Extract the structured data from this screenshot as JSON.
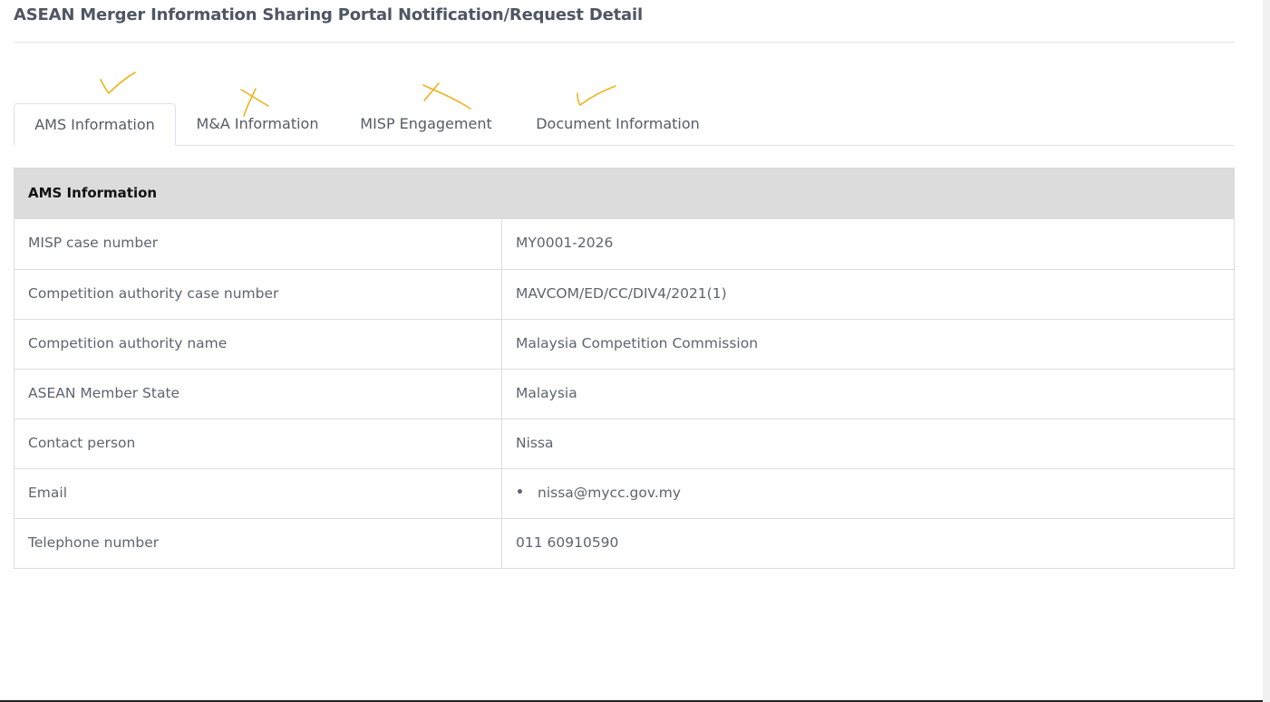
{
  "page": {
    "title": "ASEAN Merger Information Sharing Portal Notification/Request Detail"
  },
  "tabs": [
    {
      "label": "AMS Information",
      "active": true,
      "annotation": "check-mark"
    },
    {
      "label": "M&A Information",
      "active": false,
      "annotation": "cross-mark"
    },
    {
      "label": "MISP Engagement",
      "active": false,
      "annotation": "cross-mark"
    },
    {
      "label": "Document Information",
      "active": false,
      "annotation": "check-mark"
    }
  ],
  "colors": {
    "annotation_ink": "#f0b21e",
    "table_header_bg": "#dcdcdc",
    "border": "#dcdcdc"
  },
  "ams_info": {
    "header": "AMS Information",
    "rows": [
      {
        "label": "MISP case number",
        "value": "MY0001-2026"
      },
      {
        "label": "Competition authority case number",
        "value": "MAVCOM/ED/CC/DIV4/2021(1)"
      },
      {
        "label": "Competition authority name",
        "value": "Malaysia Competition Commission"
      },
      {
        "label": "ASEAN Member State",
        "value": "Malaysia"
      },
      {
        "label": "Contact person",
        "value": "Nissa"
      },
      {
        "label": "Email",
        "value": "nissa@mycc.gov.my",
        "bulleted": true
      },
      {
        "label": "Telephone number",
        "value": "011 60910590"
      }
    ]
  }
}
